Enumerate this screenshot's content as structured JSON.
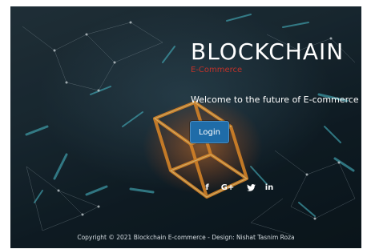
{
  "hero": {
    "title": "BLOCKCHAIN",
    "subtitle": "E-Commerce",
    "tagline": "Welcome to the future of E-commerce",
    "login_label": "Login"
  },
  "social": {
    "facebook_label": "f",
    "google_label": "G+",
    "twitter_label": "🐦",
    "linkedin_label": "in"
  },
  "footer": {
    "copyright": "Copyright © 2021 Blockchain E-commerce - Design: Nishat Tasnim Roza"
  },
  "colors": {
    "brand_red": "#c0322a",
    "button_blue": "#1f6ca8",
    "background_dark": "#1a2a33"
  }
}
